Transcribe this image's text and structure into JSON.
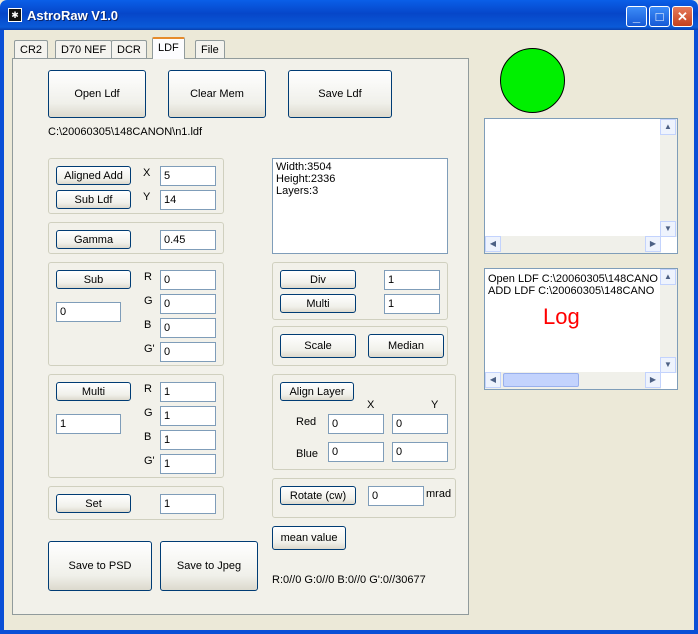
{
  "window": {
    "title": "AstroRaw V1.0",
    "min": "_",
    "max": "□",
    "close": "✕"
  },
  "tabs": [
    "CR2",
    "D70 NEF",
    "DCR",
    "LDF",
    "File"
  ],
  "toolbar": {
    "open": "Open Ldf",
    "clear": "Clear Mem",
    "save": "Save Ldf"
  },
  "file_path": "C:\\20060305\\148CANON\\n1.ldf",
  "info": {
    "lines": [
      "Width:3504",
      "Height:2336",
      "Layers:3"
    ]
  },
  "aligned": {
    "add_label": "Aligned Add",
    "sub_label": "Sub Ldf",
    "x_label": "X",
    "y_label": "Y",
    "x": "5",
    "y": "14"
  },
  "gamma": {
    "label": "Gamma",
    "value": "0.45"
  },
  "sub": {
    "label": "Sub",
    "value": "0",
    "r": "0",
    "g": "0",
    "b": "0",
    "g2": "0"
  },
  "multi": {
    "label": "Multi",
    "value": "1",
    "r": "1",
    "g": "1",
    "b": "1",
    "g2": "1"
  },
  "channels": {
    "r": "R",
    "g": "G",
    "b": "B",
    "g2": "G'"
  },
  "set": {
    "label": "Set",
    "value": "1"
  },
  "divmulti": {
    "div_label": "Div",
    "div": "1",
    "multi_label": "Multi",
    "multi": "1"
  },
  "scale": {
    "scale": "Scale",
    "median": "Median"
  },
  "align": {
    "label": "Align Layer",
    "x": "X",
    "y": "Y",
    "red": "Red",
    "blue": "Blue",
    "red_x": "0",
    "red_y": "0",
    "blue_x": "0",
    "blue_y": "0"
  },
  "rotate": {
    "label": "Rotate (cw)",
    "value": "0",
    "unit": "mrad"
  },
  "mean": {
    "label": "mean value",
    "result": "R:0//0 G:0//0 B:0//0 G':0//30677"
  },
  "savebtns": {
    "psd": "Save to PSD",
    "jpeg": "Save to Jpeg"
  },
  "log": {
    "lines": [
      "Open LDF  C:\\20060305\\148CANO",
      "ADD LDF  C:\\20060305\\148CANO"
    ],
    "label": "Log"
  },
  "colors": {
    "status": "#00f000",
    "log_label": "#ff0000",
    "titlebar": "#0a5fe8"
  }
}
